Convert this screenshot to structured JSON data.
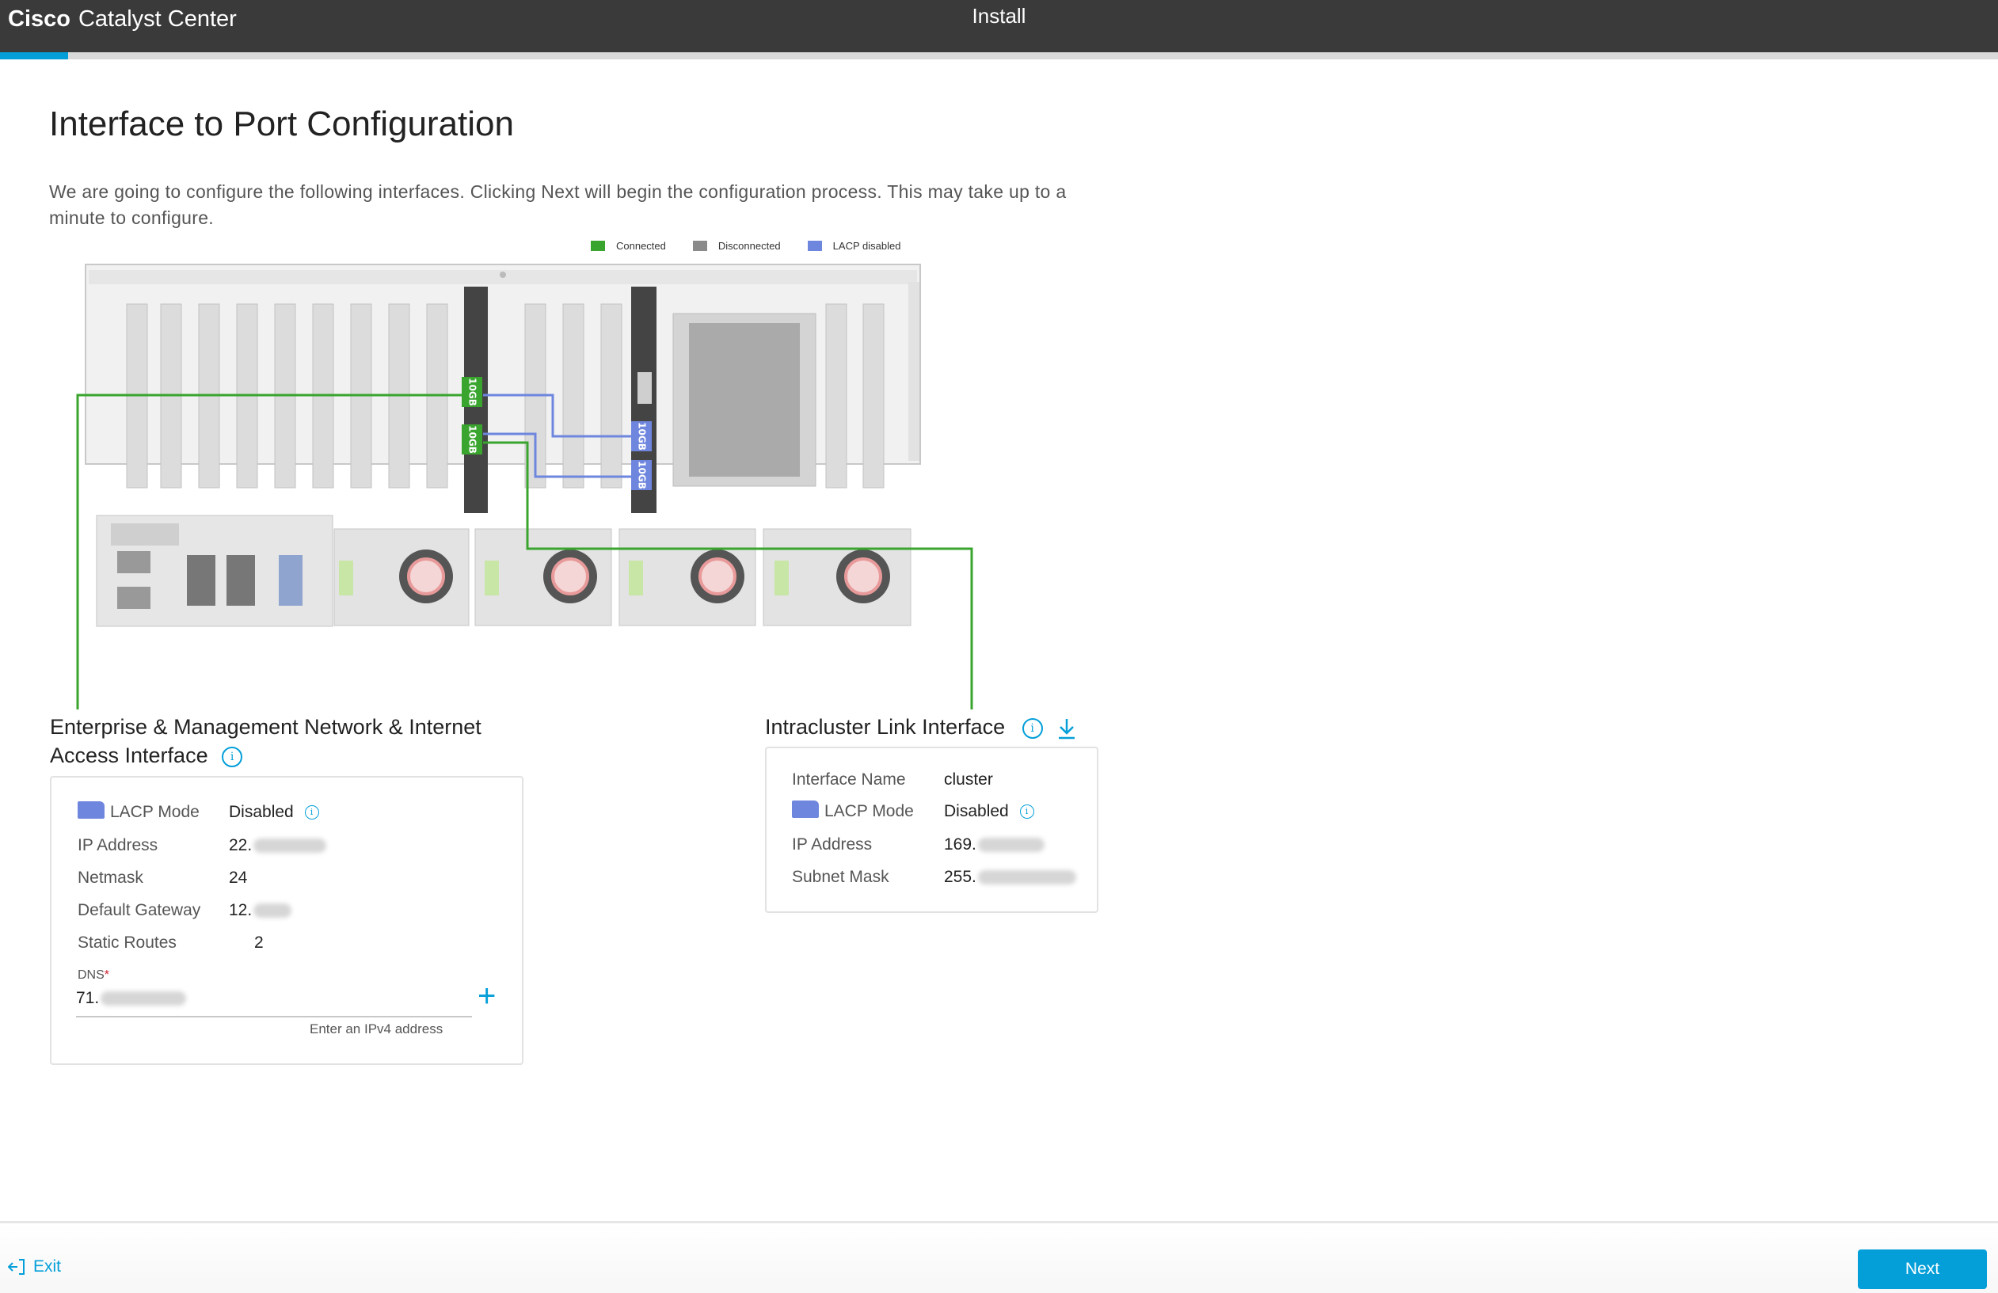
{
  "header": {
    "brand_bold": "Cisco",
    "brand_product": "Catalyst Center",
    "center_title": "Install",
    "progress_percent": 3.4
  },
  "page": {
    "title": "Interface to Port Configuration",
    "description": "We are going to configure the following interfaces. Clicking Next will begin the configuration process. This may take up to a minute to configure."
  },
  "legend": [
    {
      "label": "Connected",
      "color": "#3aa52e"
    },
    {
      "label": "Disconnected",
      "color": "#8a8a8a"
    },
    {
      "label": "LACP disabled",
      "color": "#6f86de"
    }
  ],
  "ports": {
    "label": "10GB"
  },
  "enterprise": {
    "title_line1": "Enterprise & Management Network & Internet",
    "title_line2": "Access Interface",
    "lacp_label": "LACP Mode",
    "lacp_value": "Disabled",
    "ip_label": "IP Address",
    "ip_value": "22.",
    "netmask_label": "Netmask",
    "netmask_value": "24",
    "gateway_label": "Default Gateway",
    "gateway_value": "12.",
    "routes_label": "Static Routes",
    "routes_value": "2",
    "dns_label": "DNS",
    "dns_value": "71.",
    "dns_hint": "Enter an IPv4 address"
  },
  "intracluster": {
    "title": "Intracluster Link Interface",
    "name_label": "Interface Name",
    "name_value": "cluster",
    "lacp_label": "LACP Mode",
    "lacp_value": "Disabled",
    "ip_label": "IP Address",
    "ip_value": "169.",
    "mask_label": "Subnet Mask",
    "mask_value": "255."
  },
  "footer": {
    "exit_label": "Exit",
    "next_label": "Next"
  },
  "colors": {
    "accent": "#049fd9",
    "connected": "#3aa52e",
    "lacp": "#6f86de"
  }
}
